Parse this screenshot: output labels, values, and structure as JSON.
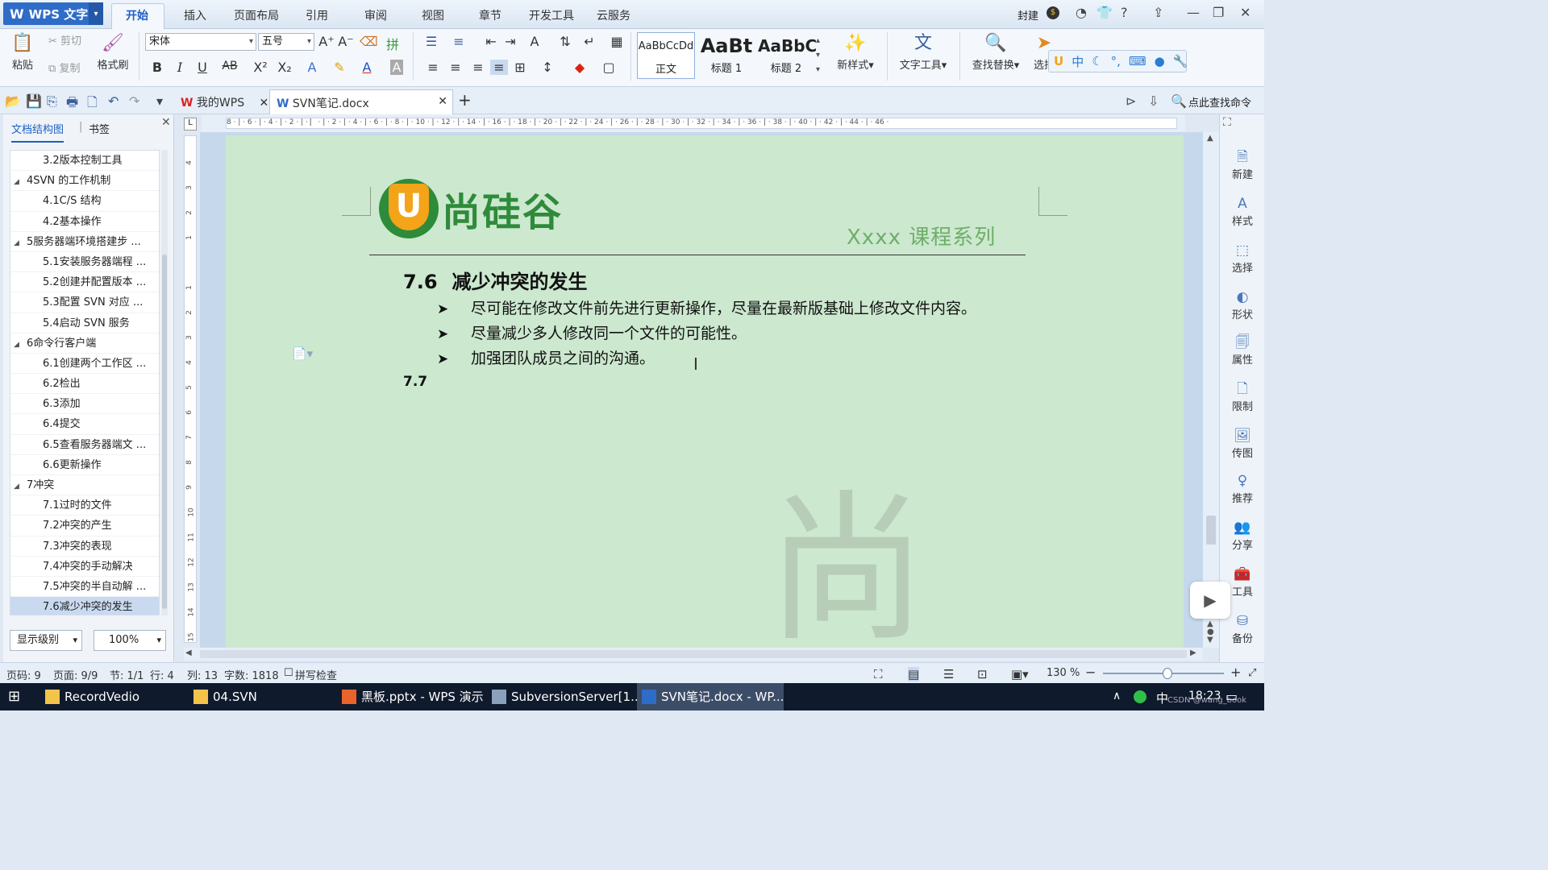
{
  "app": {
    "name": "WPS 文字"
  },
  "menu": [
    "开始",
    "插入",
    "页面布局",
    "引用",
    "审阅",
    "视图",
    "章节",
    "开发工具",
    "云服务"
  ],
  "top_right": {
    "user": "封建"
  },
  "ribbon": {
    "paste": "粘贴",
    "cut": "剪切",
    "copy": "复制",
    "format_painter": "格式刷",
    "font": "宋体",
    "font_size": "五号",
    "styles": [
      {
        "sample": "AaBbCcDd",
        "name": "正文"
      },
      {
        "sample": "AaBt",
        "name": "标题 1"
      },
      {
        "sample": "AaBbC",
        "name": "标题 2"
      }
    ],
    "new_style": "新样式",
    "text_tools": "文字工具",
    "find_replace": "查找替换",
    "select": "选择"
  },
  "quickbar": {
    "tabs": [
      {
        "label": "我的WPS"
      },
      {
        "label": "SVN笔记.docx"
      }
    ],
    "command_search": "点此查找命令"
  },
  "navpane": {
    "tab_outline": "文档结构图",
    "tab_bookmark": "书签",
    "items": [
      {
        "level": 2,
        "label": "3.2版本控制工具"
      },
      {
        "level": 1,
        "label": "4SVN 的工作机制"
      },
      {
        "level": 2,
        "label": "4.1C/S 结构"
      },
      {
        "level": 2,
        "label": "4.2基本操作"
      },
      {
        "level": 1,
        "label": "5服务器端环境搭建步 ..."
      },
      {
        "level": 2,
        "label": "5.1安装服务器端程 ..."
      },
      {
        "level": 2,
        "label": "5.2创建并配置版本 ..."
      },
      {
        "level": 2,
        "label": "5.3配置 SVN 对应 ..."
      },
      {
        "level": 2,
        "label": "5.4启动 SVN 服务"
      },
      {
        "level": 1,
        "label": "6命令行客户端"
      },
      {
        "level": 2,
        "label": "6.1创建两个工作区 ..."
      },
      {
        "level": 2,
        "label": "6.2检出"
      },
      {
        "level": 2,
        "label": "6.3添加"
      },
      {
        "level": 2,
        "label": "6.4提交"
      },
      {
        "level": 2,
        "label": "6.5查看服务器端文 ..."
      },
      {
        "level": 2,
        "label": "6.6更新操作"
      },
      {
        "level": 1,
        "label": "7冲突"
      },
      {
        "level": 2,
        "label": "7.1过时的文件"
      },
      {
        "level": 2,
        "label": "7.2冲突的产生"
      },
      {
        "level": 2,
        "label": "7.3冲突的表现"
      },
      {
        "level": 2,
        "label": "7.4冲突的手动解决"
      },
      {
        "level": 2,
        "label": "7.5冲突的半自动解 ..."
      },
      {
        "level": 2,
        "label": "7.6减少冲突的发生",
        "selected": true
      }
    ],
    "display_level": "显示级别",
    "zoom": "100%"
  },
  "ruler_h": "8 · | · 6 · | · 4 · | · 2 · | · ▏ · | · 2 · | · 4 · | · 6 · | · 8 · | · 10 · | · 12 · | · 14 · | · 16 · | · 18 · | · 20 · | · 22 · | · 24 · | · 26 · | · 28 · | · 30 · | · 32 · | · 34 · | · 36 · | · 38 · | · 40 · | · 42 · | · 44 · | · 46 ·",
  "document": {
    "logo_text": "尚硅谷",
    "logo_letter": "U",
    "series": "Xxxx 课程系列",
    "heading_num": "7.6",
    "heading_text": "减少冲突的发生",
    "bullets": [
      "尽可能在修改文件前先进行更新操作，尽量在最新版基础上修改文件内容。",
      "尽量减少多人修改同一个文件的可能性。",
      "加强团队成员之间的沟通。"
    ],
    "next_heading": "7.7",
    "watermark": "尚"
  },
  "sidebar_right": [
    "新建",
    "样式",
    "选择",
    "形状",
    "属性",
    "限制",
    "传图",
    "推荐",
    "分享",
    "工具",
    "备份"
  ],
  "status": {
    "page_code": "页码: 9",
    "pages": "页面: 9/9",
    "section": "节: 1/1",
    "row": "行: 4",
    "col": "列: 13",
    "words": "字数: 1818",
    "spell": "拼写检查",
    "zoom": "130 %"
  },
  "taskbar": {
    "items": [
      "RecordVedio",
      "04.SVN",
      "黑板.pptx - WPS 演示",
      "SubversionServer[1...",
      "SVN笔记.docx - WP..."
    ],
    "ime": "中",
    "time": "18:23",
    "watermark": "CSDN @wang_book"
  },
  "colors": {
    "accent": "#2f6cc7",
    "page_bg": "#cce8cf",
    "logo_green": "#2e8b3a",
    "logo_orange": "#f3a418"
  }
}
